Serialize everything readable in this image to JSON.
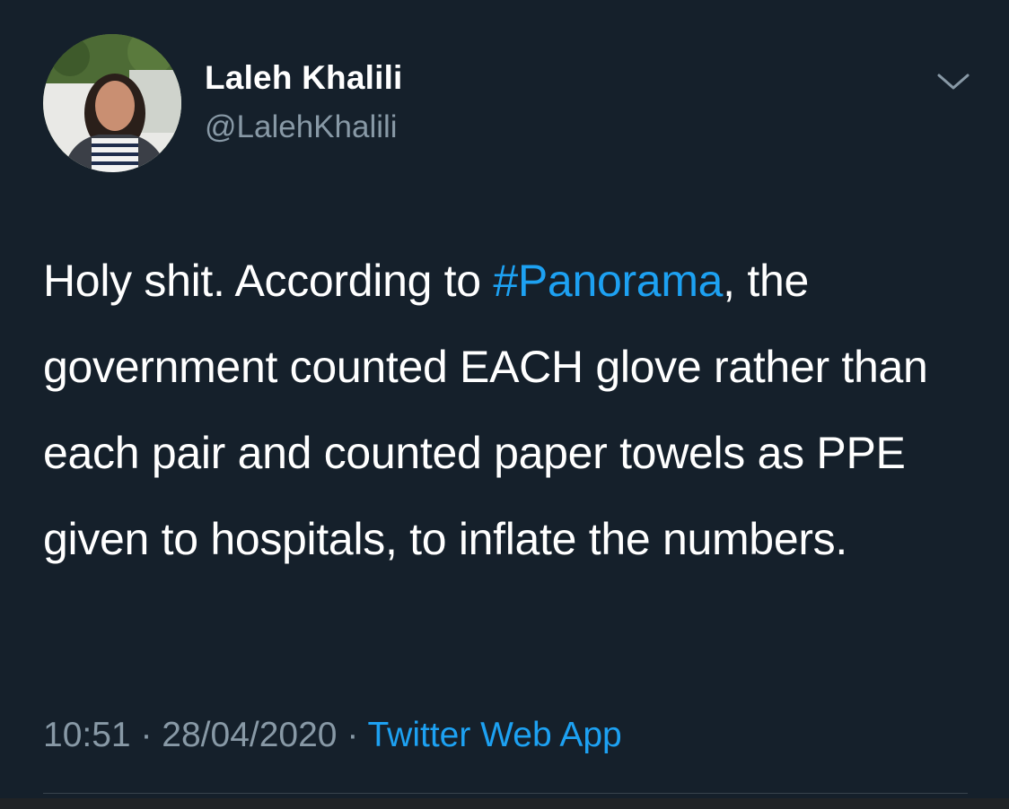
{
  "colors": {
    "background": "#15202b",
    "primary_text": "#ffffff",
    "secondary_text": "#8899a6",
    "accent": "#1da1f2",
    "divider": "#38444d"
  },
  "author": {
    "display_name": "Laleh Khalili",
    "handle": "@LalehKhalili"
  },
  "tweet": {
    "text_before_hashtag": "Holy shit. According to ",
    "hashtag": "#Panorama",
    "text_after_hashtag": ", the government counted EACH glove rather than each pair and counted paper towels as PPE given to hospitals, to inflate the numbers.",
    "time": "10:51",
    "separator": "·",
    "date": "28/04/2020",
    "source": "Twitter Web App"
  },
  "icons": {
    "menu": "chevron-down-icon"
  }
}
